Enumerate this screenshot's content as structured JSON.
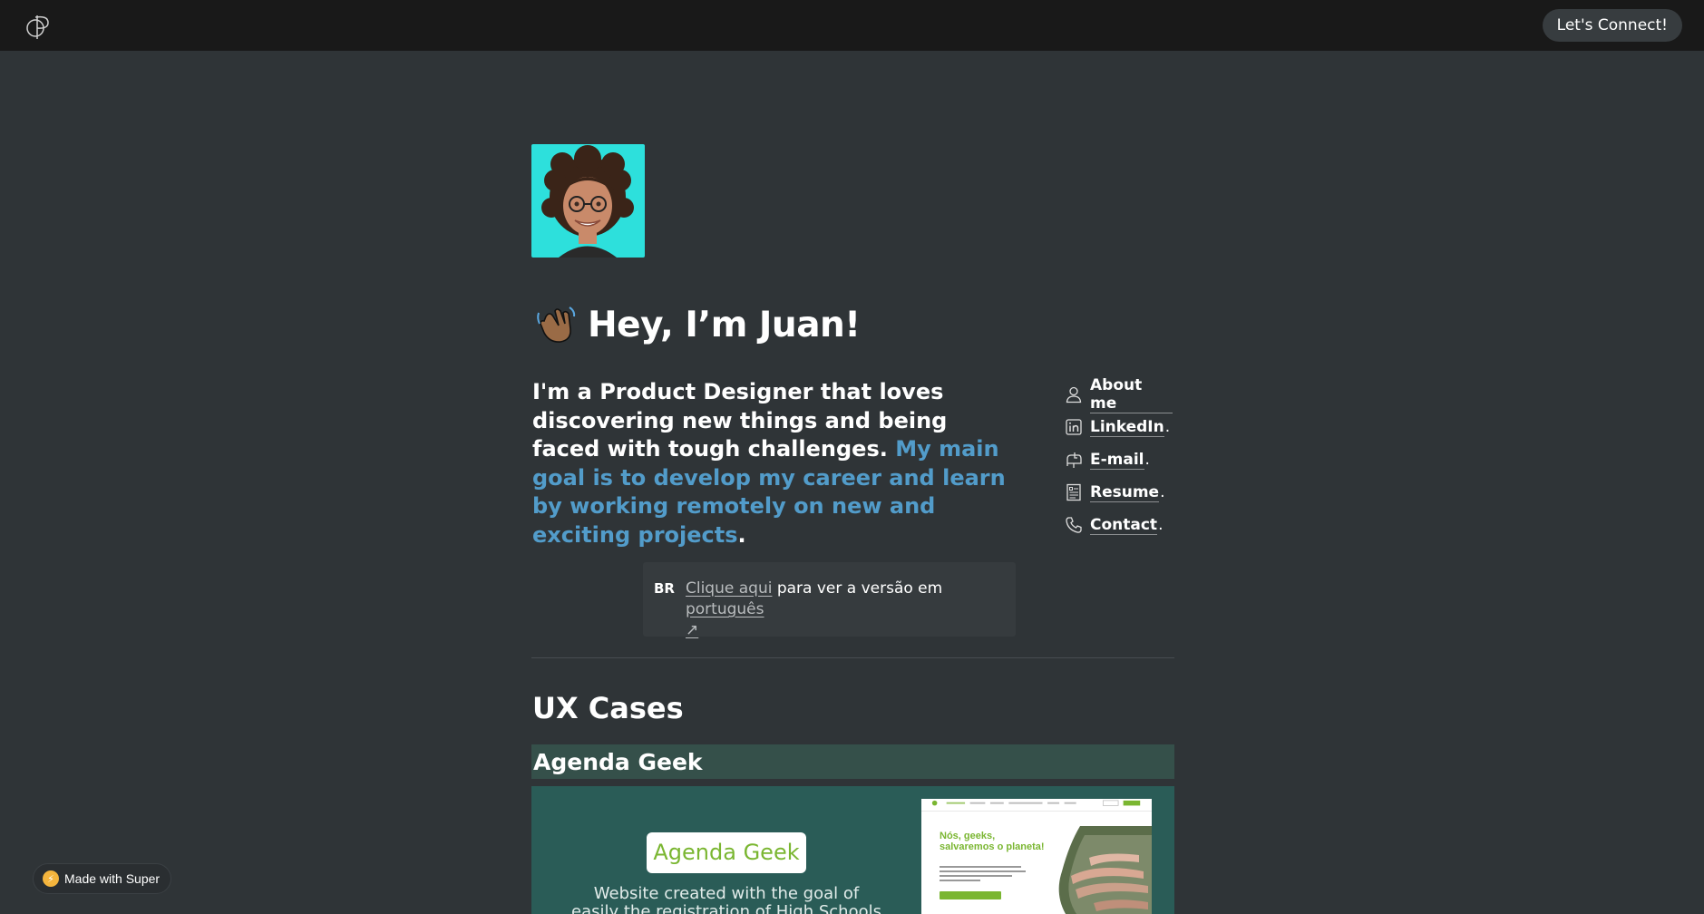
{
  "topbar": {
    "logo": "cp-monogram-logo",
    "connect_label": "Let's Connect!"
  },
  "hero": {
    "avatar": "memoji-avatar",
    "greeting": "Hey, I’m Juan!",
    "greeting_icon": "waving-hand-icon",
    "intro_plain": "I'm a Product Designer that loves discovering new things and being faced with tough challenges. ",
    "intro_highlight": "My main goal is to develop my career and learn by working remotely on new and exciting projects",
    "intro_end": "."
  },
  "links": [
    {
      "label": "About me",
      "icon": "person-icon",
      "dot": ""
    },
    {
      "label": "LinkedIn",
      "icon": "linkedin-icon",
      "dot": "."
    },
    {
      "label": "E-mail",
      "icon": "mailbox-icon",
      "dot": "."
    },
    {
      "label": "Resume",
      "icon": "document-icon",
      "dot": "."
    },
    {
      "label": "Contact",
      "icon": "phone-icon",
      "dot": "."
    }
  ],
  "callout": {
    "flag": "BR",
    "link1": "Clique aqui",
    "middle": " para ver a versão em ",
    "link2": "português",
    "arrow": "↗"
  },
  "ux": {
    "title": "UX Cases",
    "cases": [
      {
        "title": "Agenda Geek",
        "badge": "Agenda Geek",
        "description": "Website created with the goal of easily the registration of High Schools in the",
        "screenshot_headline_1": "Nós, geeks,",
        "screenshot_headline_2": "salvaremos o planeta!"
      }
    ]
  },
  "made_with": {
    "label": "Made with Super"
  },
  "colors": {
    "page_bg": "#2f3437",
    "topbar_bg": "#191919",
    "accent_blue": "#529cca",
    "avatar_bg": "#2de0dc",
    "case_bg": "#2a5c57",
    "brand_green": "#7ab631"
  }
}
